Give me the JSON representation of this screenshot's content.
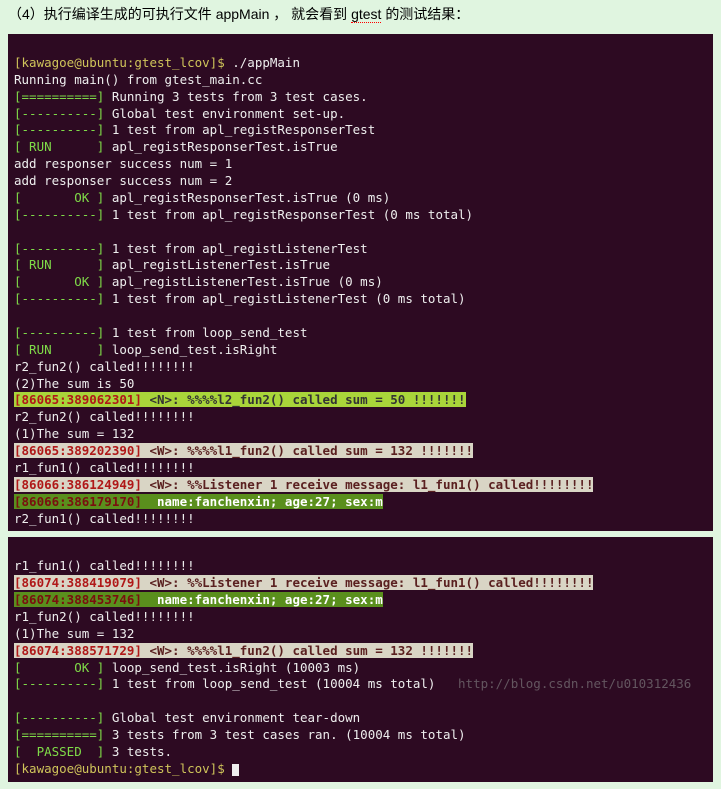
{
  "doc": {
    "prefix": "（4）执行编译生成的可执行文件  ",
    "appMain": "appMain",
    "mid": "，  就会看到 ",
    "gtest": "gtest",
    "suffix": " 的测试结果："
  },
  "t1": {
    "l1_prompt": "[kawagoe@ubuntu:gtest_lcov]$ ",
    "l1_cmd": "./appMain",
    "l2": "Running main() from gtest_main.cc",
    "l3_tag": "[==========]",
    "l3_text": " Running 3 tests from 3 test cases.",
    "l4_tag": "[----------]",
    "l4_text": " Global test environment set-up.",
    "l5_tag": "[----------]",
    "l5_text": " 1 test from apl_registResponserTest",
    "l6_tag": "[ RUN      ]",
    "l6_text": " apl_registResponserTest.isTrue",
    "l7": "add responser success num = 1",
    "l8": "add responser success num = 2",
    "l9_tag": "[       OK ]",
    "l9_text": " apl_registResponserTest.isTrue (0 ms)",
    "l10_tag": "[----------]",
    "l10_text": " 1 test from apl_registResponserTest (0 ms total)",
    "l11": "",
    "l12_tag": "[----------]",
    "l12_text": " 1 test from apl_registListenerTest",
    "l13_tag": "[ RUN      ]",
    "l13_text": " apl_registListenerTest.isTrue",
    "l14_tag": "[       OK ]",
    "l14_text": " apl_registListenerTest.isTrue (0 ms)",
    "l15_tag": "[----------]",
    "l15_text": " 1 test from apl_registListenerTest (0 ms total)",
    "l16": "",
    "l17_tag": "[----------]",
    "l17_text": " 1 test from loop_send_test",
    "l18_tag": "[ RUN      ]",
    "l18_text": " loop_send_test.isRight",
    "l19": "r2_fun2() called!!!!!!!!",
    "l20": "(2)The sum is 50",
    "l21_a": "[86065:389062301]",
    "l21_b": " <N>: %%%%l2_fun2() called sum = 50 !!!!!!!",
    "l22": "r2_fun2() called!!!!!!!!",
    "l23": "(1)The sum = 132",
    "l24_a": "[86065:389202390]",
    "l24_b": " <W>: %%%%l1_fun2() called sum = 132 !!!!!!!",
    "l25": "r1_fun1() called!!!!!!!!",
    "l26_a": "[86066:386124949]",
    "l26_b": " <W>: %%Listener 1 receive message: l1_fun1() called!!!!!!!!",
    "l27_a": "[86066:386179170]",
    "l27_b": "  name:fanchenxin; age:27; sex:m",
    "l28": "r2_fun1() called!!!!!!!!"
  },
  "t2": {
    "l1": "r1_fun1() called!!!!!!!!",
    "l2_a": "[86074:388419079]",
    "l2_b": " <W>: %%Listener 1 receive message: l1_fun1() called!!!!!!!!",
    "l3_a": "[86074:388453746]",
    "l3_b": "  name:fanchenxin; age:27; sex:m",
    "l4": "r1_fun2() called!!!!!!!!",
    "l5": "(1)The sum = 132",
    "l6_a": "[86074:388571729]",
    "l6_b": " <W>: %%%%l1_fun2() called sum = 132 !!!!!!!",
    "l7_tag": "[       OK ]",
    "l7_text": " loop_send_test.isRight (10003 ms)",
    "l8_tag": "[----------]",
    "l8_text": " 1 test from loop_send_test (10004 ms total)",
    "l9": "",
    "l10_tag": "[----------]",
    "l10_text": " Global test environment tear-down",
    "l11_tag": "[==========]",
    "l11_text": " 3 tests from 3 test cases ran. (10004 ms total)",
    "l12_tag": "[  PASSED  ]",
    "l12_text": " 3 tests.",
    "l13_prompt": "[kawagoe@ubuntu:gtest_lcov]$ "
  },
  "watermark": "http://blog.csdn.net/u010312436"
}
